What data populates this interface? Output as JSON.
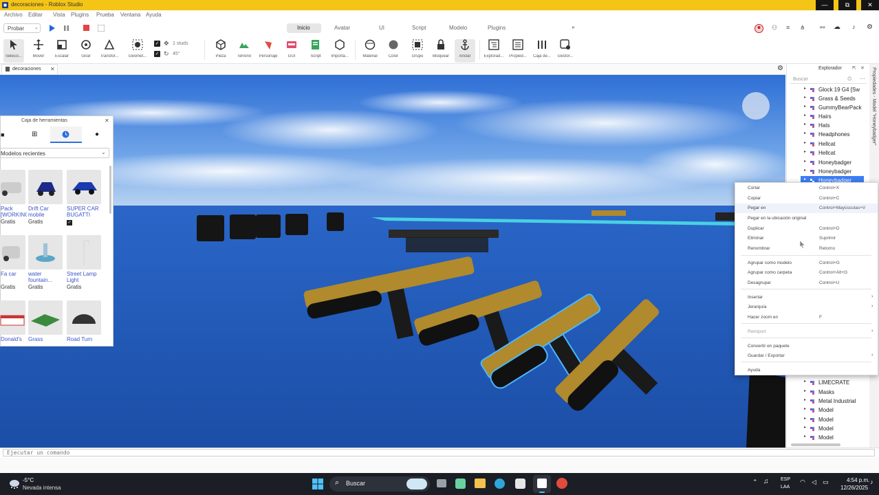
{
  "window": {
    "title": "decoraciones - Roblox Studio",
    "controls": {
      "minimize": "—",
      "maximize": "⧉",
      "close": "✕"
    }
  },
  "menu": [
    "Archivo",
    "Editar",
    "Vista",
    "Plugins",
    "Prueba",
    "Ventana",
    "Ayuda"
  ],
  "toolbar": {
    "test_label": "Probar",
    "tabs": [
      "Inicio",
      "Avatar",
      "UI",
      "Script",
      "Modelo",
      "Plugins"
    ],
    "active_tab": "Inicio"
  },
  "ribbon": {
    "tools": [
      "Selecci...",
      "Mover",
      "Escalar",
      "Girar",
      "Transfor...",
      "Geomet...",
      "Pieza",
      "Terreno",
      "Personaje",
      "GUI",
      "Script",
      "Importa...",
      "Material",
      "Color",
      "Grupo",
      "Bloquear",
      "Anclar",
      "Explorad...",
      "Propied...",
      "Caja de...",
      "Gestor..."
    ],
    "snap_move_value": "1 studs",
    "snap_rotate_value": "45°"
  },
  "document_tab": "decoraciones",
  "toolbox": {
    "title": "Caja de herramientas",
    "category_value": "Modelos recientes",
    "items": [
      {
        "name": "Pack [WORKING]",
        "price": "Gratis"
      },
      {
        "name": "Drift Car mobile",
        "price": "Gratis"
      },
      {
        "name": "SUPER CAR BUGATTI",
        "price": ""
      },
      {
        "name": "Fa car",
        "price": "Gratis"
      },
      {
        "name": "water fountain...",
        "price": "Gratis"
      },
      {
        "name": "Street Lamp Light",
        "price": "Gratis"
      },
      {
        "name": "Donald's",
        "price": ""
      },
      {
        "name": "Grass",
        "price": ""
      },
      {
        "name": "Road Turn",
        "price": ""
      }
    ]
  },
  "explorer": {
    "title": "Explorador",
    "search_placeholder": "Buscar",
    "items_top": [
      "Glock 19 G4 [Sw",
      "Grass & Seeds",
      "GummyBearPack",
      "Hairs",
      "Hats",
      "Headphones",
      "Hellcat",
      "Hellcat",
      "Honeybadger",
      "Honeybadger",
      "Honeybadger"
    ],
    "items_bottom": [
      "LIMECRATE",
      "Masks",
      "Metal Industrial",
      "Model",
      "Model",
      "Model",
      "Model"
    ],
    "properties_tab": "Propiedades - Model \"Honeybadger\""
  },
  "context_menu": {
    "items": [
      {
        "label": "Cortar",
        "shortcut": "Control+X",
        "disabled": false
      },
      {
        "label": "Copiar",
        "shortcut": "Control+C",
        "disabled": false
      },
      {
        "label": "Pegar en",
        "shortcut": "Control+Mayúsculas+V",
        "disabled": false
      },
      {
        "label": "Pegar en la ubicación original",
        "shortcut": "",
        "disabled": false
      },
      {
        "label": "Duplicar",
        "shortcut": "Control+D",
        "disabled": false
      },
      {
        "label": "Eliminar",
        "shortcut": "Suprimir",
        "disabled": false
      },
      {
        "label": "Renombrar",
        "shortcut": "Retorno",
        "disabled": false
      },
      {
        "label": "Agrupar como modelo",
        "shortcut": "Control+G",
        "disabled": false
      },
      {
        "label": "Agrupar como carpeta",
        "shortcut": "Control+Alt+G",
        "disabled": false
      },
      {
        "label": "Desagrupar",
        "shortcut": "Control+U",
        "disabled": false
      },
      {
        "label": "Insertar",
        "shortcut": "",
        "disabled": false
      },
      {
        "label": "Jerarquía",
        "shortcut": "",
        "disabled": false
      },
      {
        "label": "Hacer zoom en",
        "shortcut": "F",
        "disabled": false
      },
      {
        "label": "Reimport",
        "shortcut": "",
        "disabled": true
      },
      {
        "label": "Convertir en paquete",
        "shortcut": "",
        "disabled": false
      },
      {
        "label": "Guardar / Exportar",
        "shortcut": "",
        "disabled": false
      },
      {
        "label": "Ayuda",
        "shortcut": "",
        "disabled": false
      }
    ]
  },
  "command_bar": {
    "placeholder": "Ejecutar un comando"
  },
  "taskbar": {
    "weather_temp": "-5°C",
    "weather_desc": "Nevada intensa",
    "search_label": "Buscar",
    "lang_top": "ESP",
    "lang_bottom": "LAA",
    "time": "4:54 p.m.",
    "date": "12/26/2025"
  },
  "colors": {
    "title_bar": "#f4c516",
    "selection": "#3d7ef4",
    "taskbar": "#1b1e24",
    "link": "#3a56c7"
  }
}
